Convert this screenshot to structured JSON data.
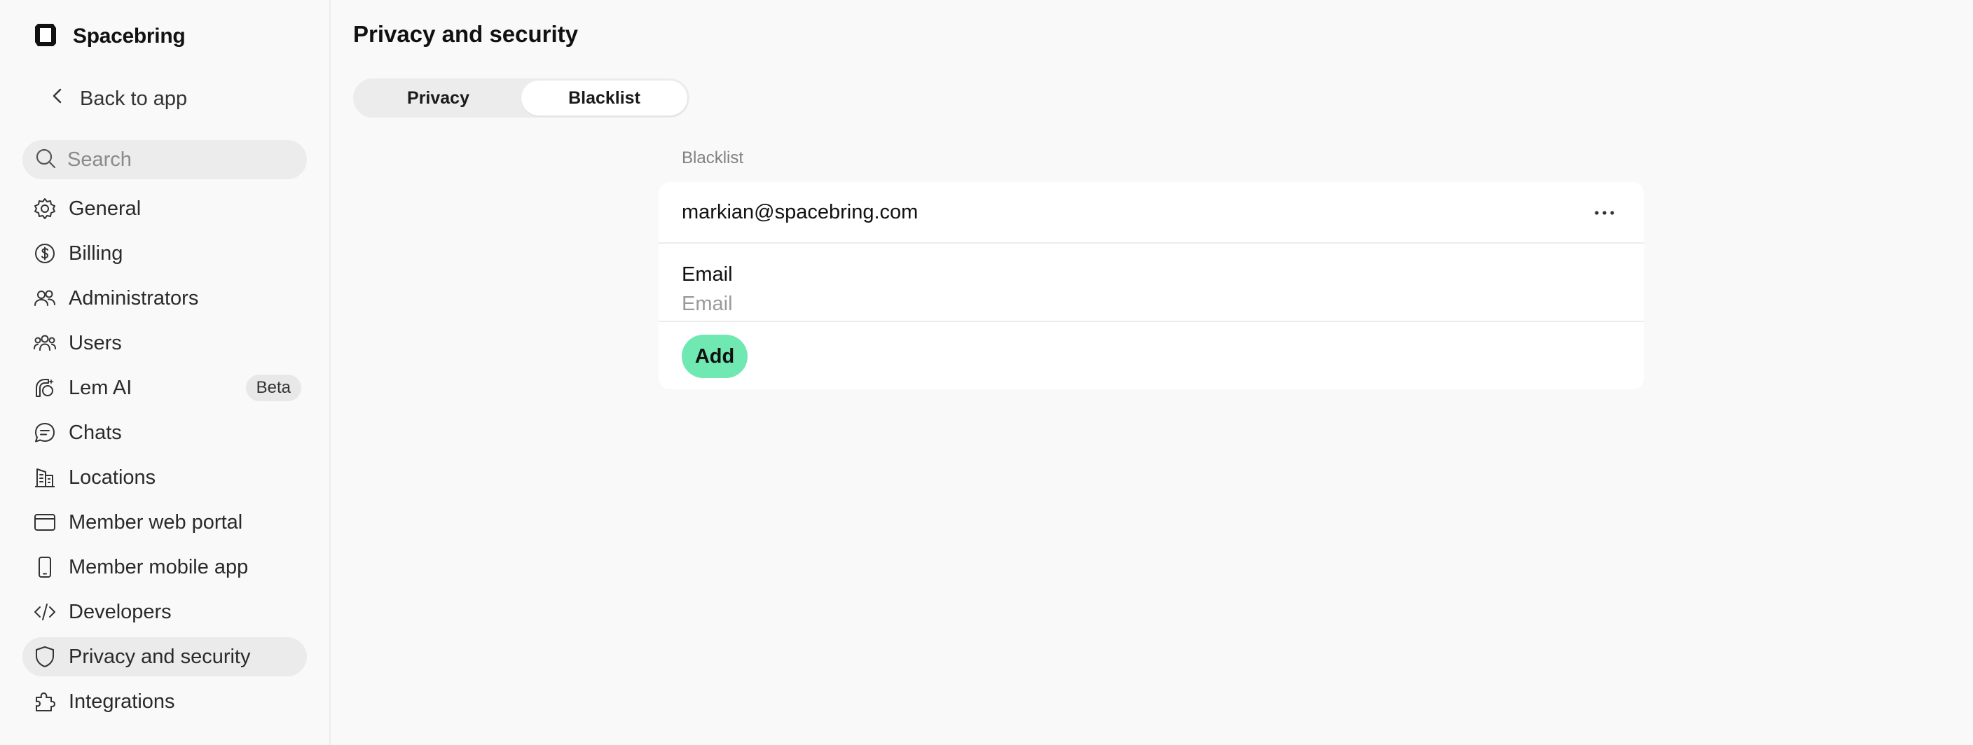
{
  "brand": {
    "name": "Spacebring"
  },
  "sidebar": {
    "back_label": "Back to app",
    "search_placeholder": "Search",
    "items": [
      {
        "label": "General",
        "icon": "gear-icon"
      },
      {
        "label": "Billing",
        "icon": "dollar-circle-icon"
      },
      {
        "label": "Administrators",
        "icon": "users-icon"
      },
      {
        "label": "Users",
        "icon": "user-group-icon"
      },
      {
        "label": "Lem AI",
        "icon": "ai-icon",
        "badge": "Beta"
      },
      {
        "label": "Chats",
        "icon": "chat-icon"
      },
      {
        "label": "Locations",
        "icon": "building-icon"
      },
      {
        "label": "Member web portal",
        "icon": "browser-icon"
      },
      {
        "label": "Member mobile app",
        "icon": "mobile-icon"
      },
      {
        "label": "Developers",
        "icon": "code-icon"
      },
      {
        "label": "Privacy and security",
        "icon": "shield-icon",
        "active": true
      },
      {
        "label": "Integrations",
        "icon": "puzzle-icon"
      }
    ]
  },
  "main": {
    "title": "Privacy and security",
    "tabs": [
      {
        "label": "Privacy",
        "active": false
      },
      {
        "label": "Blacklist",
        "active": true
      }
    ],
    "section_label": "Blacklist",
    "entries": [
      {
        "email": "markian@spacebring.com"
      }
    ],
    "field": {
      "label": "Email",
      "placeholder": "Email",
      "value": ""
    },
    "add_label": "Add"
  },
  "colors": {
    "accent": "#6fe8b1",
    "background": "#f9f9f9",
    "active_nav": "#ebebeb"
  }
}
